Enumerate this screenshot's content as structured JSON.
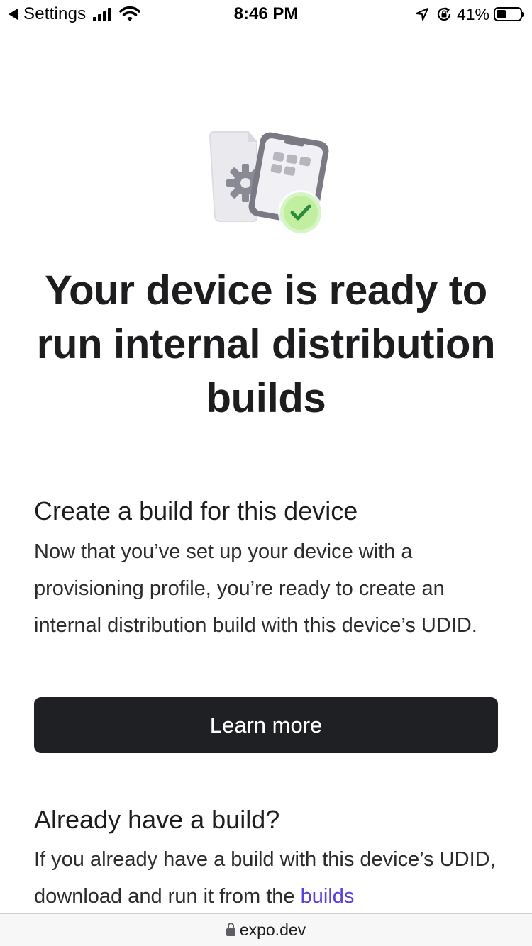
{
  "status_bar": {
    "back_label": "Settings",
    "time": "8:46 PM",
    "battery_percent": "41%",
    "battery_level": 0.41,
    "signal_bars": 4,
    "icons": [
      "back-arrow-icon",
      "cellular-signal-icon",
      "wifi-icon",
      "location-arrow-icon",
      "orientation-lock-icon",
      "battery-icon"
    ]
  },
  "hero": {
    "illustration": "device-provisioned-illustration",
    "title": "Your device is ready to run internal distribution builds"
  },
  "create_section": {
    "title": "Create a build for this device",
    "body": "Now that you’ve set up your device with a provisioning profile, you’re ready to create an internal distribution build with this device’s UDID.",
    "button_label": "Learn more"
  },
  "existing_section": {
    "title": "Already have a build?",
    "body_prefix": "If you already have a build with this device’s UDID, download and run it from the ",
    "link_text": "builds"
  },
  "url_bar": {
    "domain": "expo.dev"
  },
  "colors": {
    "button_bg": "#1f2023",
    "link": "#5b3fd9",
    "check_green": "#2e8b3e"
  }
}
